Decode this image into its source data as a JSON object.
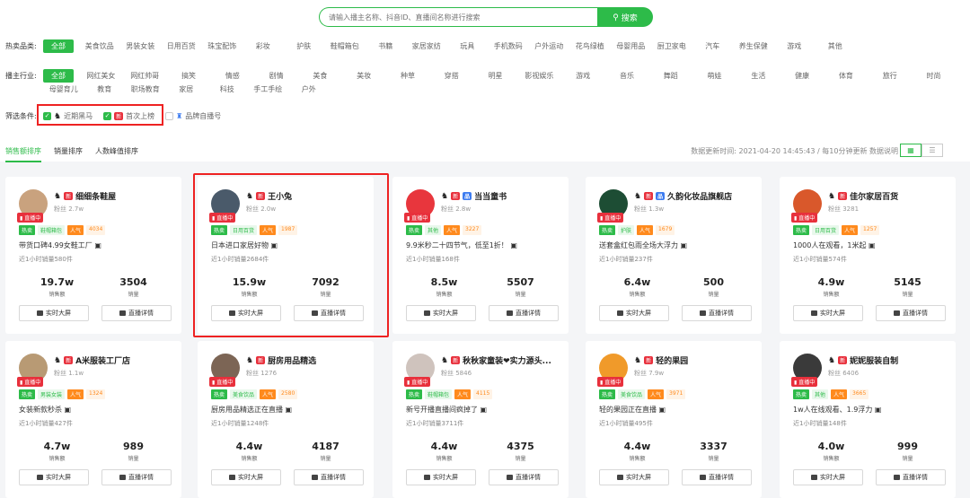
{
  "search": {
    "placeholder": "请输入播主名称、抖音ID、直播间名称进行搜索",
    "button_label": "搜索"
  },
  "filters": {
    "category_label": "热卖品类:",
    "categories": [
      "全部",
      "美食饮品",
      "男装女装",
      "日用百货",
      "珠宝配饰",
      "彩妆",
      "护肤",
      "鞋帽箱包",
      "书籍",
      "家居家纺",
      "玩具",
      "手机数码",
      "户外运动",
      "花鸟绿植",
      "母婴用品",
      "厨卫家电",
      "汽车",
      "养生保健",
      "游戏",
      "其他"
    ],
    "industry_label": "播主行业:",
    "industries_row1": [
      "全部",
      "网红美女",
      "网红帅哥",
      "搞笑",
      "情感",
      "剧情",
      "美食",
      "美妆",
      "种草",
      "穿搭",
      "明星",
      "影视娱乐",
      "游戏",
      "音乐",
      "舞蹈",
      "萌娃",
      "生活",
      "健康",
      "体育",
      "旅行",
      "时尚"
    ],
    "industries_row2": [
      "母婴育儿",
      "教育",
      "职场教育",
      "家居",
      "科技",
      "手工手绘",
      "户外"
    ],
    "condition_label": "筛选条件:",
    "conditions": [
      "近期黑马",
      "首次上榜",
      "品牌自播号"
    ],
    "condition_badge": "新"
  },
  "tabs": [
    "销售额排序",
    "销量排序",
    "人数峰值排序"
  ],
  "update_text": "数据更新时间: 2021-04-20 14:45:43 / 每10分钟更新   数据说明",
  "labels": {
    "live": "直播中",
    "hot": "热卖",
    "popularity": "人气",
    "sales_amount": "销售额",
    "sales": "销量",
    "screen_btn": "实时大屏",
    "detail_btn": "直播详情",
    "new": "新",
    "brand": "品"
  },
  "cards": [
    {
      "name": "细细条鞋屋",
      "fans": "粉丝 2.7w",
      "category": "鞋帽箱包",
      "pop": "4034",
      "title": "带货口碑4.99女鞋工厂",
      "recent": "近1小时销量580件",
      "amount": "19.7w",
      "sales": "3504",
      "avatar_color": "#c9a27e",
      "brand": false
    },
    {
      "name": "王小兔",
      "fans": "粉丝 2.0w",
      "category": "日用百货",
      "pop": "1987",
      "title": "日本进口家居好物",
      "recent": "近1小时销量2684件",
      "amount": "15.9w",
      "sales": "7092",
      "avatar_color": "#4a5a6a",
      "brand": false
    },
    {
      "name": "当当童书",
      "fans": "粉丝 2.8w",
      "category": "其他",
      "pop": "3227",
      "title": "9.9米秒二十四节气，低至1折！",
      "recent": "近1小时销量168件",
      "amount": "8.5w",
      "sales": "5507",
      "avatar_color": "#e8363d",
      "brand": true
    },
    {
      "name": "久韵化妆品旗舰店",
      "fans": "粉丝 1.3w",
      "category": "护肤",
      "pop": "1679",
      "title": "送套盒红包雨全场大浮力",
      "recent": "近1小时销量237件",
      "amount": "6.4w",
      "sales": "500",
      "avatar_color": "#1d4d34",
      "brand": true
    },
    {
      "name": "佳尔家居百货",
      "fans": "粉丝 3281",
      "category": "日用百货",
      "pop": "1257",
      "title": "1000人在观看，1米起",
      "recent": "近1小时销量574件",
      "amount": "4.9w",
      "sales": "5145",
      "avatar_color": "#d9582b",
      "brand": false
    },
    {
      "name": "A米服装工厂店",
      "fans": "粉丝 1.1w",
      "category": "男装女装",
      "pop": "1324",
      "title": "女装新款秒杀",
      "recent": "近1小时销量427件",
      "amount": "4.7w",
      "sales": "989",
      "avatar_color": "#b89a74",
      "brand": false
    },
    {
      "name": "厨房用品精选",
      "fans": "粉丝 1276",
      "category": "美食饮品",
      "pop": "2580",
      "title": "厨房用品精选正在直播",
      "recent": "近1小时销量1248件",
      "amount": "4.4w",
      "sales": "4187",
      "avatar_color": "#7c6555",
      "brand": false
    },
    {
      "name": "秋秋家童装❤实力源头...",
      "fans": "粉丝 5846",
      "category": "鞋帽箱包",
      "pop": "4115",
      "title": "新号开播直播间疯掉了",
      "recent": "近1小时销量3711件",
      "amount": "4.4w",
      "sales": "4375",
      "avatar_color": "#cfc3bd",
      "brand": false
    },
    {
      "name": "轻的果园",
      "fans": "粉丝 7.9w",
      "category": "美食饮品",
      "pop": "3971",
      "title": "轻的果园正在直播",
      "recent": "近1小时销量495件",
      "amount": "4.4w",
      "sales": "3337",
      "avatar_color": "#f09a2a",
      "brand": false
    },
    {
      "name": "妮妮服装自制",
      "fans": "粉丝 6406",
      "category": "其他",
      "pop": "3665",
      "title": "1w人在线观看、1.9浮力",
      "recent": "近1小时销量148件",
      "amount": "4.0w",
      "sales": "999",
      "avatar_color": "#3a3a3a",
      "brand": false
    }
  ]
}
